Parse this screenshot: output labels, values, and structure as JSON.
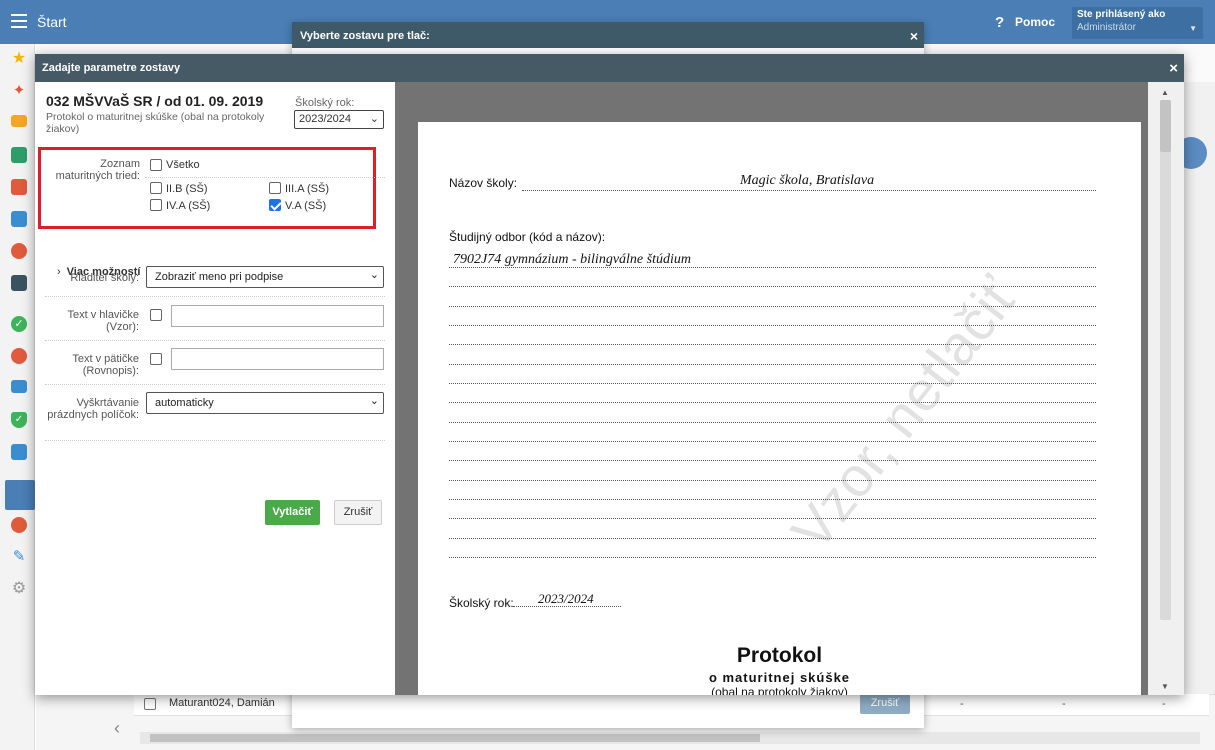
{
  "topbar": {
    "title": "Štart",
    "help_icon": "?",
    "help_label": "Pomoc",
    "user_line1": "Ste prihlásený ako",
    "user_line2": "Administrátor"
  },
  "sidebar_icons": [
    "star-icon",
    "magic-wand-icon",
    "mail-icon",
    "home-icon",
    "calendar-icon",
    "notebook-icon",
    "person-icon",
    "schedule-icon",
    "check-circle-icon",
    "chart-badge-icon",
    "briefcase-icon",
    "shield-check-icon",
    "bar-chart-icon",
    "open-book-icon",
    "chat-icon",
    "pen-icon",
    "gear-icon"
  ],
  "background_dialog": {
    "title": "Vyberte zostavu pre tlač:",
    "close": "×",
    "cancel_label": "Zrušiť"
  },
  "background_row": {
    "name": "Maturant024, Damián",
    "dashes": [
      "-",
      "-",
      "-",
      "-"
    ]
  },
  "dialog": {
    "title": "Zadajte parametre zostavy",
    "close": "×"
  },
  "report": {
    "title": "032 MŠVVaŠ SR / od 01. 09. 2019",
    "subtitle": "Protokol o maturitnej skúške (obal na protokoly žiakov)",
    "year_label": "Školský rok:",
    "year_value": "2023/2024"
  },
  "classes": {
    "label": "Zoznam maturitných tried:",
    "all_label": "Všetko",
    "all_checked": false,
    "items": [
      {
        "label": "II.B (SŠ)",
        "checked": false
      },
      {
        "label": "III.A (SŠ)",
        "checked": false
      },
      {
        "label": "IV.A (SŠ)",
        "checked": false
      },
      {
        "label": "V.A (SŠ)",
        "checked": true
      }
    ]
  },
  "more_options": "Viac možností",
  "fields": {
    "director_label": "Riaditeľ školy:",
    "director_value": "Zobraziť meno pri podpise",
    "header_label": "Text v hlavičke (Vzor):",
    "header_checked": false,
    "header_value": "",
    "footer_label": "Text v pätičke (Rovnopis):",
    "footer_checked": false,
    "footer_value": "",
    "strike_label": "Vyškrtávanie prázdnych políčok:",
    "strike_value": "automaticky"
  },
  "buttons": {
    "print": "Vytlačiť",
    "cancel": "Zrušiť"
  },
  "preview": {
    "school_label": "Názov školy:",
    "school_value": "Magic škola, Bratislava",
    "field_label": "Študijný odbor (kód a názov):",
    "field_value": "7902J74 gymnázium - bilingválne štúdium",
    "year_label": "Školský rok:",
    "year_value": "2023/2024",
    "watermark": "Vzor, netlačiť",
    "doc_title": "Protokol",
    "doc_sub1": "o maturitnej skúške",
    "doc_sub2": "(obal na protokoly žiakov)"
  }
}
